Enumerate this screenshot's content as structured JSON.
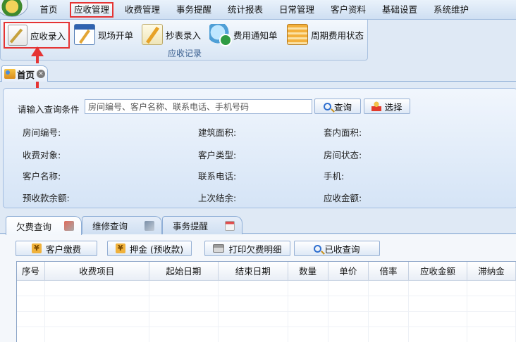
{
  "menu": {
    "items": [
      "首页",
      "应收管理",
      "收费管理",
      "事务提醒",
      "统计报表",
      "日常管理",
      "客户资料",
      "基础设置",
      "系统维护"
    ],
    "active": "应收管理"
  },
  "ribbon": {
    "buttons": [
      {
        "label": "应收录入",
        "icon": "notepad-pen-icon"
      },
      {
        "label": "现场开单",
        "icon": "form-pen-icon"
      },
      {
        "label": "抄表录入",
        "icon": "pencil-sheet-icon"
      },
      {
        "label": "费用通知单",
        "icon": "notice-refresh-icon"
      },
      {
        "label": "周期费用状态",
        "icon": "ledger-icon"
      }
    ],
    "group_label": "应收记录"
  },
  "doc_tab": {
    "title": "首页",
    "close": "×"
  },
  "query": {
    "label": "请输入查询条件",
    "placeholder": "房间编号、客户名称、联系电话、手机号码",
    "search_button": "查询",
    "select_button": "选择"
  },
  "fields": [
    "房间编号:",
    "建筑面积:",
    "套内面积:",
    "收费对象:",
    "客户类型:",
    "房间状态:",
    "客户名称:",
    "联系电话:",
    "手机:",
    "预收款余额:",
    "上次结余:",
    "应收金额:"
  ],
  "tabs": [
    {
      "label": "欠费查询",
      "icon": "box-icon"
    },
    {
      "label": "维修查询",
      "icon": "wrench-icon"
    },
    {
      "label": "事务提醒",
      "icon": "calendar-clock-icon"
    }
  ],
  "actions": {
    "pay": "客户缴费",
    "deposit": "押金 (预收款)",
    "print": "打印欠费明细",
    "paid": "已收查询"
  },
  "table": {
    "columns": [
      "序号",
      "收费项目",
      "起始日期",
      "结束日期",
      "数量",
      "单价",
      "倍率",
      "应收金额",
      "滞纳金"
    ]
  },
  "colors": {
    "highlight": "#e53434",
    "accent": "#2f6fcf"
  }
}
